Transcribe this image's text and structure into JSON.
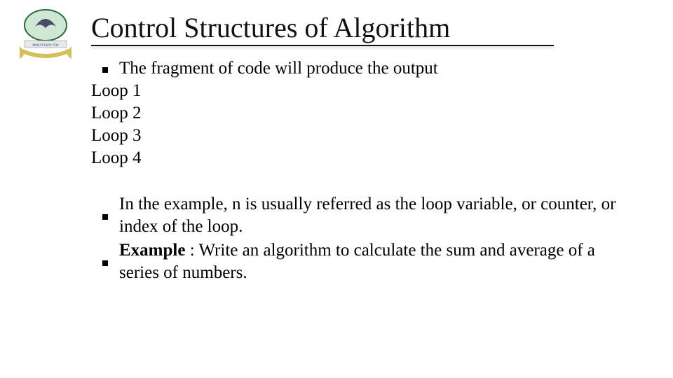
{
  "title": "Control Structures of Algorithm",
  "body": {
    "intro": "The fragment of code will produce the output",
    "outputs": [
      "Loop 1",
      "Loop 2",
      "Loop 3",
      "Loop 4"
    ],
    "points": [
      "In the example, n is usually referred as the loop variable, or counter, or index of the loop."
    ],
    "example": {
      "label": "Example",
      "text": " : Write an algorithm to calculate the sum and average of a series of numbers."
    }
  }
}
